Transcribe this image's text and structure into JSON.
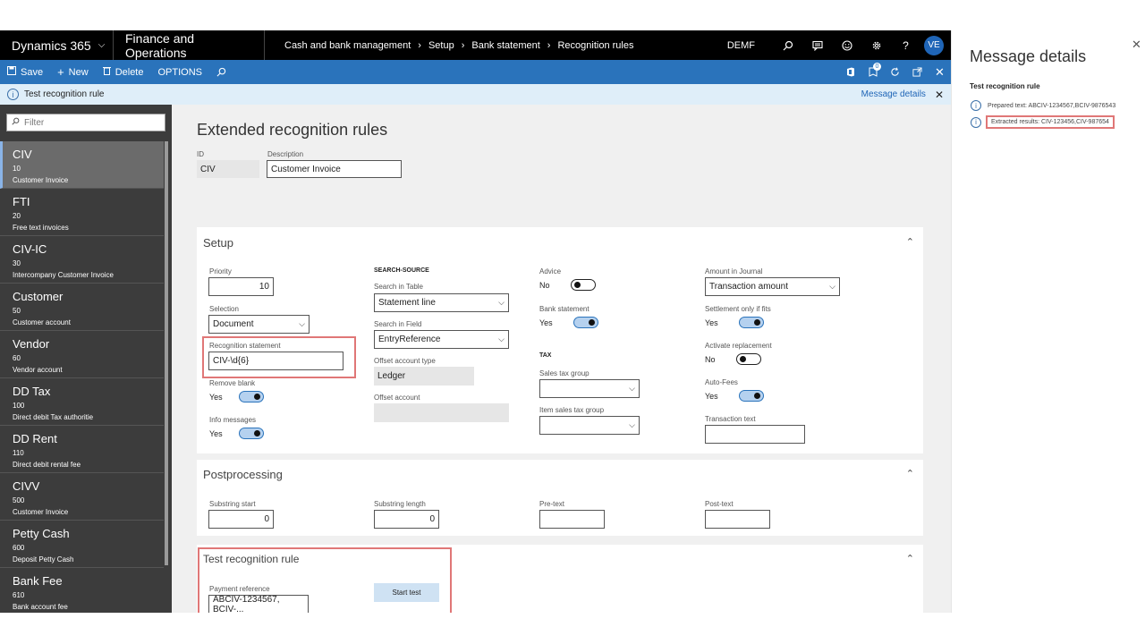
{
  "navbar": {
    "app": "Dynamics 365",
    "module": "Finance and Operations",
    "breadcrumb": [
      "Cash and bank management",
      "Setup",
      "Bank statement",
      "Recognition rules"
    ],
    "company": "DEMF",
    "avatar": "VE"
  },
  "actions": {
    "save": "Save",
    "new": "New",
    "delete": "Delete",
    "options": "OPTIONS",
    "notification_count": "0"
  },
  "message_bar": {
    "text": "Test recognition rule",
    "details_link": "Message details"
  },
  "list": {
    "filter_placeholder": "Filter",
    "items": [
      {
        "id": "CIV",
        "num": "10",
        "desc": "Customer Invoice"
      },
      {
        "id": "FTI",
        "num": "20",
        "desc": "Free text invoices"
      },
      {
        "id": "CIV-IC",
        "num": "30",
        "desc": "Intercompany Customer Invoice"
      },
      {
        "id": "Customer",
        "num": "50",
        "desc": "Customer account"
      },
      {
        "id": "Vendor",
        "num": "60",
        "desc": "Vendor account"
      },
      {
        "id": "DD Tax",
        "num": "100",
        "desc": "Direct debit Tax authoritie"
      },
      {
        "id": "DD Rent",
        "num": "110",
        "desc": "Direct debit rental fee"
      },
      {
        "id": "CIVV",
        "num": "500",
        "desc": "Customer Invoice"
      },
      {
        "id": "Petty Cash",
        "num": "600",
        "desc": "Deposit Petty Cash"
      },
      {
        "id": "Bank Fee",
        "num": "610",
        "desc": "Bank account fee"
      }
    ]
  },
  "form": {
    "title": "Extended recognition rules",
    "id_label": "ID",
    "id_value": "CIV",
    "desc_label": "Description",
    "desc_value": "Customer Invoice"
  },
  "setup": {
    "title": "Setup",
    "priority_label": "Priority",
    "priority_value": "10",
    "selection_label": "Selection",
    "selection_value": "Document",
    "recognition_label": "Recognition statement",
    "recognition_value": "CIV-\\d{6}",
    "remove_blank_label": "Remove blank",
    "remove_blank_value": "Yes",
    "info_messages_label": "Info messages",
    "info_messages_value": "Yes",
    "search_source_header": "SEARCH-SOURCE",
    "search_table_label": "Search in Table",
    "search_table_value": "Statement line",
    "search_field_label": "Search in Field",
    "search_field_value": "EntryReference",
    "offset_type_label": "Offset account type",
    "offset_type_value": "Ledger",
    "offset_account_label": "Offset account",
    "advice_label": "Advice",
    "advice_value": "No",
    "bank_statement_label": "Bank statement",
    "bank_statement_value": "Yes",
    "tax_header": "TAX",
    "sales_tax_label": "Sales tax group",
    "item_sales_tax_label": "Item sales tax group",
    "amount_journal_label": "Amount in Journal",
    "amount_journal_value": "Transaction amount",
    "settlement_label": "Settlement only if fits",
    "settlement_value": "Yes",
    "activate_replacement_label": "Activate replacement",
    "activate_replacement_value": "No",
    "auto_fees_label": "Auto-Fees",
    "auto_fees_value": "Yes",
    "transaction_text_label": "Transaction text"
  },
  "postprocessing": {
    "title": "Postprocessing",
    "substring_start_label": "Substring start",
    "substring_start_value": "0",
    "substring_length_label": "Substring length",
    "substring_length_value": "0",
    "pre_text_label": "Pre-text",
    "post_text_label": "Post-text"
  },
  "test": {
    "title": "Test recognition rule",
    "payment_ref_label": "Payment reference",
    "payment_ref_value": "ABCIV-1234567, BCIV-...",
    "start_button": "Start test"
  },
  "message_details": {
    "title": "Message details",
    "subtitle": "Test recognition rule",
    "messages": [
      "Prepared text: ABCIV-1234567,BCIV-9876543",
      "Extracted results: CIV-123456,CIV-987654"
    ]
  },
  "colors": {
    "accent": "#2a73bb",
    "highlight": "#e07777",
    "list_bg": "#3c3c3c"
  }
}
